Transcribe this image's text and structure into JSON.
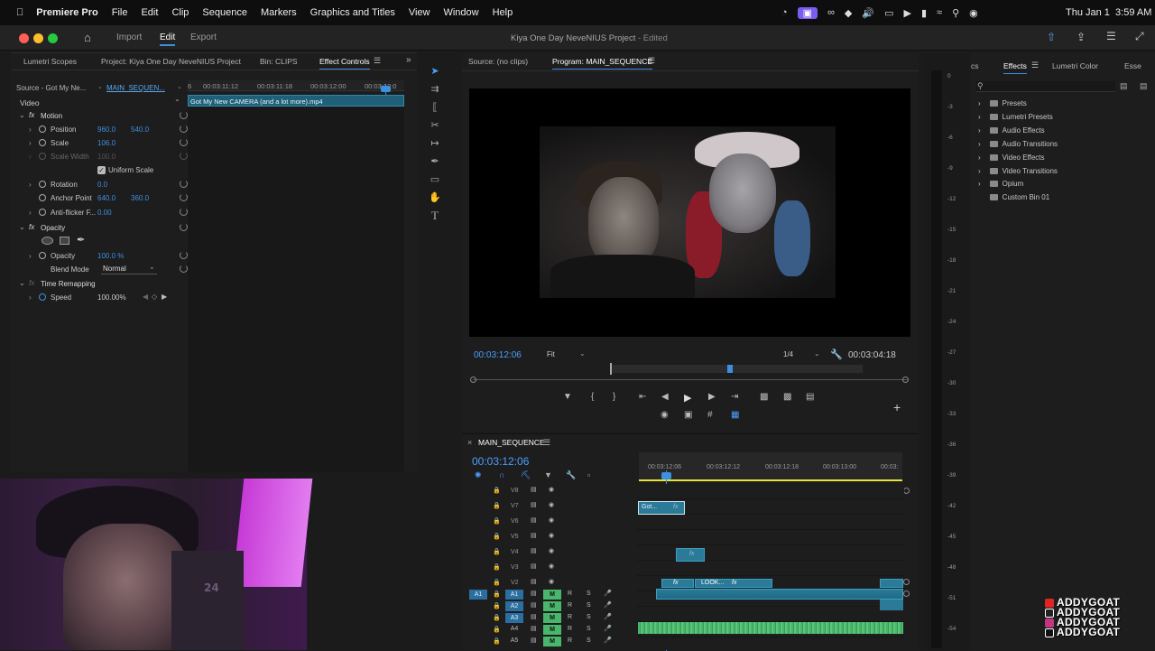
{
  "menubar": {
    "app_name": "Premiere Pro",
    "items": [
      "File",
      "Edit",
      "Clip",
      "Sequence",
      "Markers",
      "Graphics and Titles",
      "View",
      "Window",
      "Help"
    ],
    "clock": "Thu Jan 1  3:59 AM"
  },
  "titlebar": {
    "workspaces": [
      "Import",
      "Edit",
      "Export"
    ],
    "active_workspace": "Edit",
    "project_title": "Kiya One Day NeveNIUS Project",
    "status": "- Edited"
  },
  "fx_panel": {
    "tabs": [
      "Lumetri Scopes",
      "Project: Kiya One Day NeveNIUS Project",
      "Bin: CLIPS",
      "Effect Controls"
    ],
    "active_tab": "Effect Controls",
    "source_label": "Source - Got My Ne...",
    "sequence_label": "MAIN_SEQUEN...",
    "mini_ruler": [
      "6",
      "00:03:11:12",
      "00:03:11:18",
      "00:03:12:00",
      "00:03:12:0"
    ],
    "clip_name": "Got My New CAMERA (and a lot more).mp4",
    "video_header": "Video",
    "motion": "Motion",
    "position_label": "Position",
    "position_x": "960.0",
    "position_y": "540.0",
    "scale_label": "Scale",
    "scale_value": "106.0",
    "scale_width_label": "Scale Width",
    "scale_width_value": "100.0",
    "uniform_scale": "Uniform Scale",
    "rotation_label": "Rotation",
    "rotation_value": "0.0",
    "anchor_label": "Anchor Point",
    "anchor_x": "640.0",
    "anchor_y": "360.0",
    "antiflicker_label": "Anti-flicker F...",
    "antiflicker_value": "0.00",
    "opacity_header": "Opacity",
    "opacity_label": "Opacity",
    "opacity_value": "100.0 %",
    "blend_label": "Blend Mode",
    "blend_value": "Normal",
    "time_remap": "Time Remapping",
    "speed_label": "Speed",
    "speed_value": "100.00%"
  },
  "program": {
    "source_tab": "Source: (no clips)",
    "program_tab": "Program: MAIN_SEQUENCE",
    "timecode": "00:03:12:06",
    "fit": "Fit",
    "resolution": "1/4",
    "duration": "00:03:04:18"
  },
  "timeline": {
    "sequence_name": "MAIN_SEQUENCE",
    "timecode": "00:03:12:06",
    "ruler": [
      "00:03:12:06",
      "00:03:12:12",
      "00:03:12:18",
      "00:03:13:00",
      "00:03:"
    ],
    "video_tracks": [
      "V8",
      "V7",
      "V6",
      "V5",
      "V4",
      "V3",
      "V2"
    ],
    "audio_tracks": [
      "A1",
      "A2",
      "A3",
      "A4",
      "A5"
    ],
    "source_patch": "A1",
    "clip_v7": "Got...",
    "clip_v2_label": "LOOK...",
    "fx": "fx",
    "m_label": "M",
    "r_label": "R",
    "s_label": "S"
  },
  "meter": {
    "ticks": [
      "0",
      "-3",
      "-6",
      "-9",
      "-12",
      "-15",
      "-18",
      "-21",
      "-24",
      "-27",
      "-30",
      "-33",
      "-36",
      "-39",
      "-42",
      "-45",
      "-48",
      "-51",
      "-54"
    ]
  },
  "effects_panel": {
    "tabs": [
      "cs",
      "Effects",
      "Lumetri Color",
      "Esse"
    ],
    "active_tab": "Effects",
    "folders": [
      "Presets",
      "Lumetri Presets",
      "Audio Effects",
      "Audio Transitions",
      "Video Effects",
      "Video Transitions",
      "Opium",
      "Custom Bin 01"
    ]
  },
  "webcam": {
    "jersey_number": "24"
  },
  "watermark": {
    "lines": [
      "ADDYGOAT",
      "ADDYGOAT",
      "ADDYGOAT",
      "ADDYGOAT"
    ],
    "colors": [
      "#e02424",
      "#222222",
      "#c13584",
      "#111111"
    ]
  },
  "colors": {
    "accent": "#3d8fe0",
    "clip_blue": "#2a7a98",
    "audio_green": "#49b76b",
    "work_area_yellow": "#e6e43a"
  }
}
